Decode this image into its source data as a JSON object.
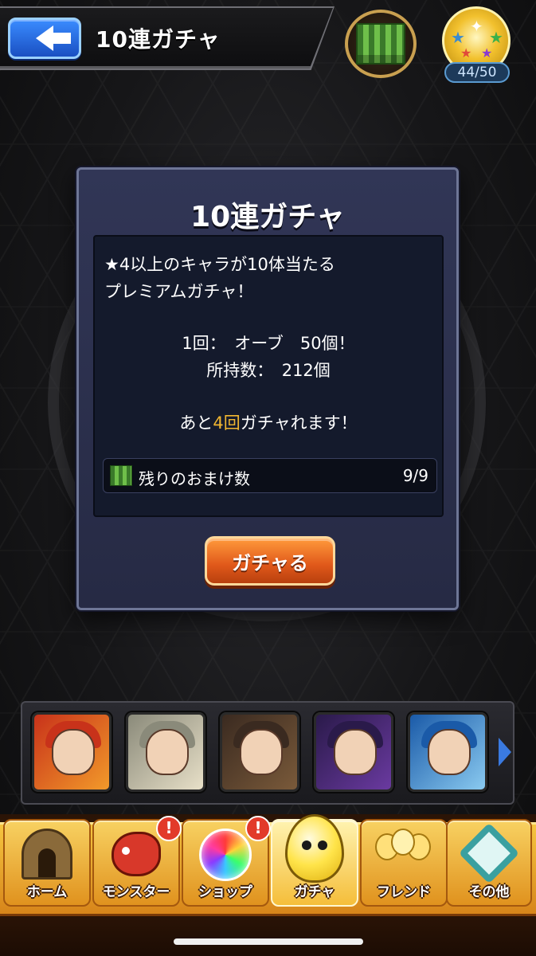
{
  "header": {
    "back_label": "",
    "title": "10連ガチャ",
    "stamina": "44/50"
  },
  "dialog": {
    "title": "10連ガチャ",
    "description_line1": "★4以上のキャラが10体当たる",
    "description_line2": "プレミアムガチャ！",
    "cost_line": "1回：　オーブ　50個！",
    "owned_line": "所持数：　212個",
    "remaining_prefix": "あと",
    "remaining_count": "4回",
    "remaining_suffix": "ガチャれます！",
    "bonus_label": "残りのおまけ数",
    "bonus_value": "9/9",
    "gacha_button": "ガチャる"
  },
  "featured_characters": [
    {
      "name": "character-1",
      "colors": [
        "#c8321a",
        "#f29a2a"
      ]
    },
    {
      "name": "character-2",
      "colors": [
        "#8a8a7a",
        "#e8e0c8"
      ]
    },
    {
      "name": "character-3",
      "colors": [
        "#3a2a20",
        "#7a5a3a"
      ]
    },
    {
      "name": "character-4",
      "colors": [
        "#2a1a4a",
        "#6a3aa0"
      ]
    },
    {
      "name": "character-5",
      "colors": [
        "#1a5aa8",
        "#8acaf0"
      ]
    }
  ],
  "bottom_nav": {
    "items": [
      {
        "label": "ホーム",
        "icon": "home-gate-icon",
        "alert": ""
      },
      {
        "label": "モンスター",
        "icon": "monster-icon",
        "alert": "!"
      },
      {
        "label": "ショップ",
        "icon": "orb-icon",
        "alert": "!"
      },
      {
        "label": "ガチャ",
        "icon": "gacha-egg-icon",
        "alert": ""
      },
      {
        "label": "フレンド",
        "icon": "friend-balloons-icon",
        "alert": ""
      },
      {
        "label": "その他",
        "icon": "other-icon",
        "alert": ""
      }
    ],
    "active_index": 3
  },
  "colors": {
    "accent_orange": "#e0581a",
    "highlight_gold": "#f2b731",
    "panel_blue": "#313656"
  }
}
